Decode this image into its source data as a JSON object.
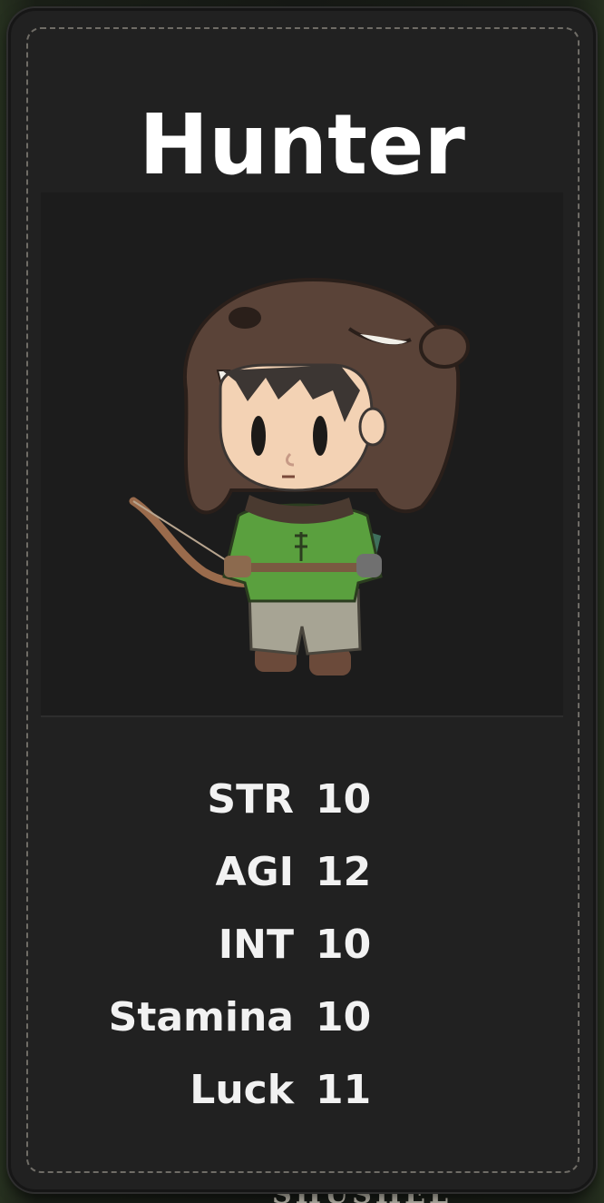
{
  "character_card": {
    "class_name": "Hunter",
    "stats": [
      {
        "label": "STR",
        "value": "10"
      },
      {
        "label": "AGI",
        "value": "12"
      },
      {
        "label": "INT",
        "value": "10"
      },
      {
        "label": "Stamina",
        "value": "10"
      },
      {
        "label": "Luck",
        "value": "11"
      }
    ]
  },
  "portrait": {
    "character": "hunter-portrait",
    "colors": {
      "hood": "#5a4338",
      "tunic": "#5aa03e",
      "pants": "#a7a494",
      "skin": "#f3d2b4",
      "hair": "#3c3633",
      "bow": "#9a6b4c"
    }
  },
  "background_peek_text": "SHUSHEL"
}
